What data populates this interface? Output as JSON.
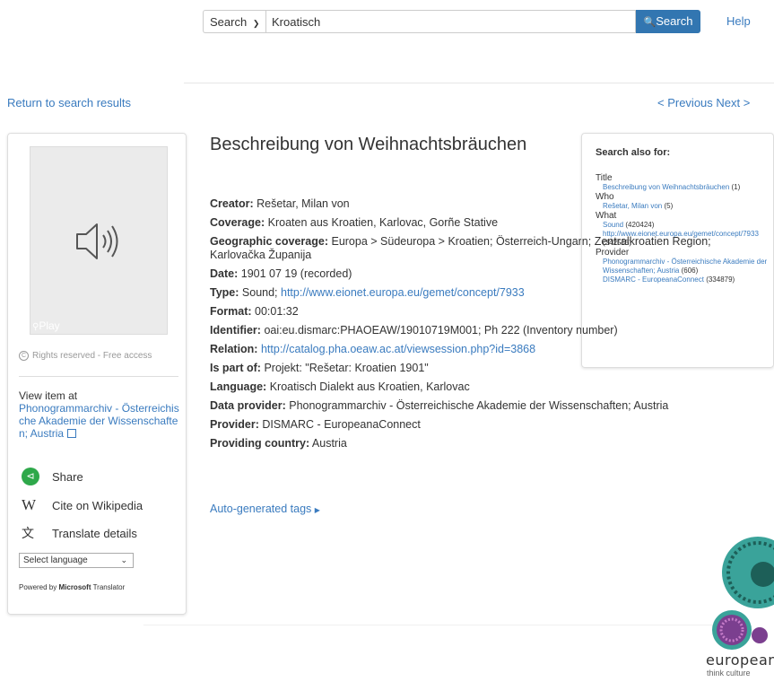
{
  "search": {
    "scope_label": "Search",
    "query": "Kroatisch",
    "button_label": "Search",
    "help_label": "Help"
  },
  "nav": {
    "return_label": "Return to search results",
    "previous_label": "< Previous",
    "next_label": "Next >"
  },
  "media": {
    "play_label": "Play",
    "rights": "Rights reserved - Free access"
  },
  "left": {
    "view_item_at": "View item at",
    "provider_link": "Phonogrammarchiv - Österreichische Akademie der Wissenschaften; Austria",
    "share_label": "Share",
    "cite_label": "Cite on Wikipedia",
    "translate_label": "Translate details",
    "select_language": "Select language",
    "powered_prefix": "Powered by",
    "powered_brand": "Microsoft",
    "powered_suffix": "Translator"
  },
  "record": {
    "title": "Beschreibung von Weihnachtsbräuchen",
    "fields": [
      {
        "label": "Creator:",
        "value": "Rešetar, Milan von",
        "link": ""
      },
      {
        "label": "Coverage:",
        "value": "Kroaten aus Kroatien, Karlovac, Gorñe Stative",
        "link": ""
      },
      {
        "label": "Geographic coverage:",
        "value": "Europa > Südeuropa > Kroatien; Österreich-Ungarn; Zentralkroatien Region; Karlovačka Županija",
        "link": ""
      },
      {
        "label": "Date:",
        "value": "1901 07 19 (recorded)",
        "link": ""
      },
      {
        "label": "Type:",
        "value": "Sound; ",
        "link": "http://www.eionet.europa.eu/gemet/concept/7933"
      },
      {
        "label": "Format:",
        "value": "00:01:32",
        "link": ""
      },
      {
        "label": "Identifier:",
        "value": "oai:eu.dismarc:PHAOEAW/19010719M001; Ph 222 (Inventory number)",
        "link": ""
      },
      {
        "label": "Relation:",
        "value": "",
        "link": "http://catalog.pha.oeaw.ac.at/viewsession.php?id=3868"
      },
      {
        "label": "Is part of:",
        "value": "Projekt: \"Rešetar: Kroatien 1901\"",
        "link": ""
      },
      {
        "label": "Language:",
        "value": "Kroatisch Dialekt aus Kroatien, Karlovac",
        "link": ""
      },
      {
        "label": "Data provider:",
        "value": "Phonogrammarchiv - Österreichische Akademie der Wissenschaften; Austria",
        "link": ""
      },
      {
        "label": "Provider:",
        "value": "DISMARC - EuropeanaConnect",
        "link": ""
      },
      {
        "label": "Providing country:",
        "value": "Austria",
        "link": ""
      }
    ],
    "auto_tags_label": "Auto-generated tags"
  },
  "search_also": {
    "heading": "Search also for:",
    "groups": [
      {
        "category": "Title",
        "items": [
          {
            "link": "Beschreibung von Weihnachtsbräuchen",
            "count": "(1)"
          }
        ]
      },
      {
        "category": "Who",
        "items": [
          {
            "link": "Rešetar, Milan von",
            "count": "(5)"
          }
        ]
      },
      {
        "category": "What",
        "items": [
          {
            "link": "Sound",
            "count": "(420424)"
          },
          {
            "link": "http://www.eionet.europa.eu/gemet/concept/7933",
            "count": "(342515)"
          }
        ]
      },
      {
        "category": "Provider",
        "items": [
          {
            "link": "Phonogrammarchiv - Österreichische Akademie der Wissenschaften; Austria",
            "count": "(606)"
          },
          {
            "link": "DISMARC - EuropeanaConnect",
            "count": "(334879)"
          }
        ]
      }
    ]
  },
  "logo": {
    "wordmark": "europeana",
    "tagline": "think culture"
  },
  "colors": {
    "link": "#3a7bbf",
    "search_button": "#3276b1",
    "share_green": "#2ea84a",
    "logo_teal": "#3aa39a",
    "logo_purple": "#7b3f8f"
  }
}
